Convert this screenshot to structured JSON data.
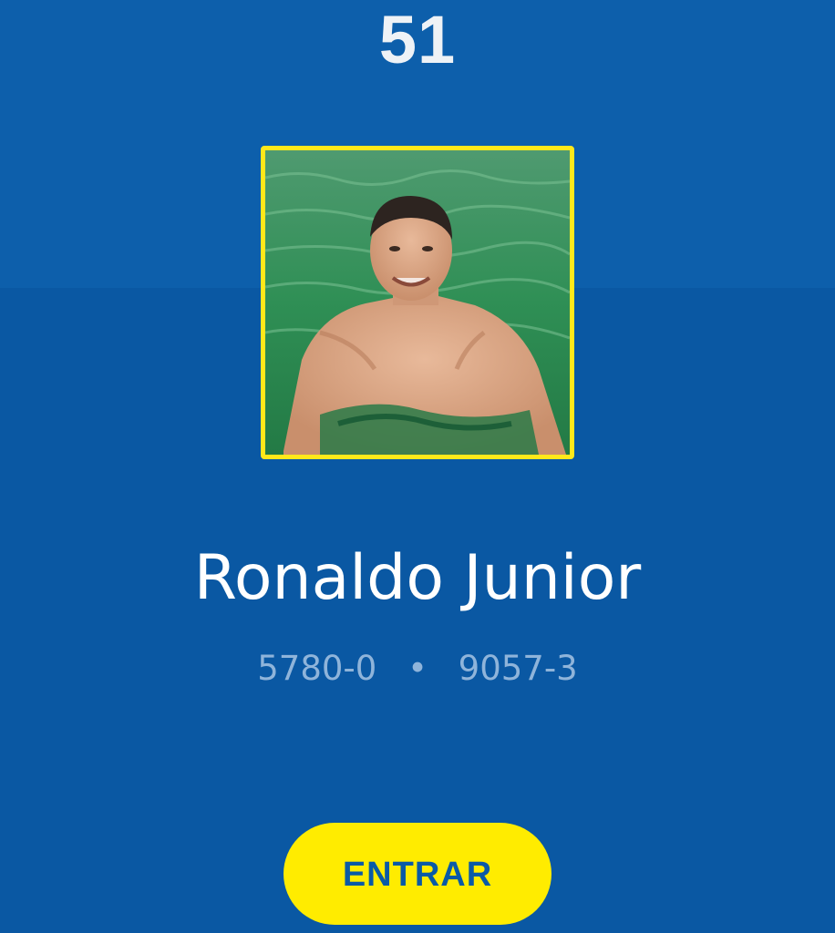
{
  "header": {
    "number": "51"
  },
  "profile": {
    "photo": {
      "alt": "profile-photo",
      "frame_color": "#ffe81a"
    },
    "name": "Ronaldo Junior",
    "agency": "5780-0",
    "separator": "•",
    "account": "9057-3"
  },
  "actions": {
    "enter_label": "ENTRAR"
  },
  "colors": {
    "background": "#0a5aa6",
    "accent": "#ffec00",
    "text_primary": "#ffffff",
    "text_secondary": "#8fb4da"
  }
}
